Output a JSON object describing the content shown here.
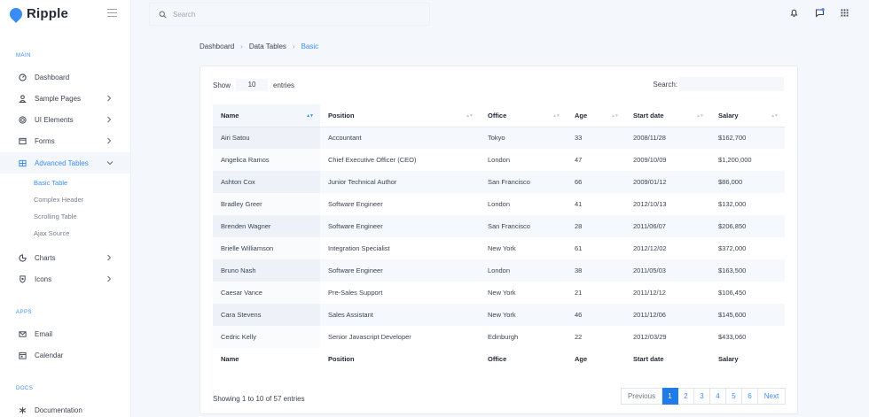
{
  "brand": {
    "name": "Ripple"
  },
  "sidebar": {
    "sections": {
      "main": "MAIN",
      "apps": "APPS",
      "docs": "DOCS"
    },
    "main_items": [
      {
        "label": "Dashboard",
        "icon": "dashboard-icon"
      },
      {
        "label": "Sample Pages",
        "icon": "user-icon"
      },
      {
        "label": "UI Elements",
        "icon": "target-icon"
      },
      {
        "label": "Forms",
        "icon": "form-icon"
      },
      {
        "label": "Advanced Tables",
        "icon": "table-icon"
      },
      {
        "label": "Charts",
        "icon": "chart-icon"
      },
      {
        "label": "Icons",
        "icon": "lifebuoy-icon"
      }
    ],
    "sub_items": [
      "Basic Table",
      "Complex Header",
      "Scrolling Table",
      "Ajax Source"
    ],
    "app_items": [
      {
        "label": "Email",
        "icon": "mail-icon"
      },
      {
        "label": "Calendar",
        "icon": "calendar-icon"
      }
    ],
    "doc_items": [
      {
        "label": "Documentation",
        "icon": "asterisk-icon"
      }
    ]
  },
  "topbar": {
    "search_placeholder": "Search"
  },
  "breadcrumb": [
    "Dashboard",
    "Data Tables",
    "Basic"
  ],
  "table_controls": {
    "show_label": "Show",
    "entries_value": "10",
    "entries_label": "entries",
    "search_label": "Search:"
  },
  "table": {
    "columns": [
      "Name",
      "Position",
      "Office",
      "Age",
      "Start date",
      "Salary"
    ],
    "rows": [
      [
        "Airi Satou",
        "Accountant",
        "Tokyo",
        "33",
        "2008/11/28",
        "$162,700"
      ],
      [
        "Angelica Ramos",
        "Chief Executive Officer (CEO)",
        "London",
        "47",
        "2009/10/09",
        "$1,200,000"
      ],
      [
        "Ashton Cox",
        "Junior Technical Author",
        "San Francisco",
        "66",
        "2009/01/12",
        "$86,000"
      ],
      [
        "Bradley Greer",
        "Software Engineer",
        "London",
        "41",
        "2012/10/13",
        "$132,000"
      ],
      [
        "Brenden Wagner",
        "Software Engineer",
        "San Francisco",
        "28",
        "2011/06/07",
        "$206,850"
      ],
      [
        "Brielle Williamson",
        "Integration Specialist",
        "New York",
        "61",
        "2012/12/02",
        "$372,000"
      ],
      [
        "Bruno Nash",
        "Software Engineer",
        "London",
        "38",
        "2011/05/03",
        "$163,500"
      ],
      [
        "Caesar Vance",
        "Pre-Sales Support",
        "New York",
        "21",
        "2011/12/12",
        "$106,450"
      ],
      [
        "Cara Stevens",
        "Sales Assistant",
        "New York",
        "46",
        "2011/12/06",
        "$145,600"
      ],
      [
        "Cedric Kelly",
        "Senior Javascript Developer",
        "Edinburgh",
        "22",
        "2012/03/29",
        "$433,060"
      ]
    ]
  },
  "footer": {
    "info": "Showing 1 to 10 of 57 entries",
    "prev": "Previous",
    "next": "Next",
    "pages": [
      "1",
      "2",
      "3",
      "4",
      "5",
      "6"
    ]
  },
  "colors": {
    "accent": "#3a8cf5",
    "active_page": "#1e7be8"
  }
}
